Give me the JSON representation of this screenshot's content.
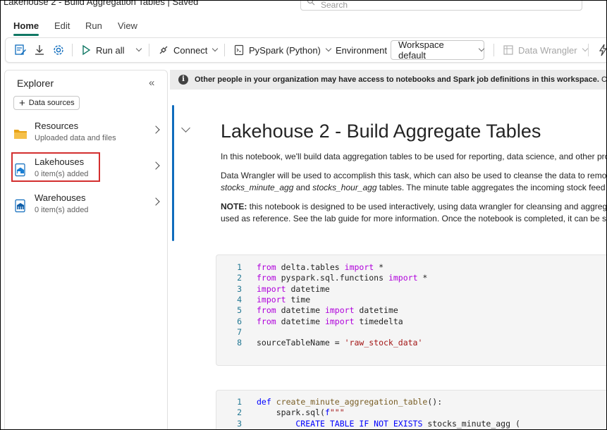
{
  "window": {
    "title": "Lakehouse 2 - Build Aggregation Tables | Saved",
    "search_placeholder": "Search"
  },
  "tabs": [
    {
      "label": "Home",
      "active": true
    },
    {
      "label": "Edit",
      "active": false
    },
    {
      "label": "Run",
      "active": false
    },
    {
      "label": "View",
      "active": false
    }
  ],
  "toolbar": {
    "run_all": "Run all",
    "connect": "Connect",
    "language": "PySpark (Python)",
    "environment": "Environment",
    "workspace": "Workspace default",
    "data_wrangler": "Data Wrangler"
  },
  "explorer": {
    "title": "Explorer",
    "data_sources_button": "Data sources",
    "items": [
      {
        "name": "Resources",
        "sub": "Uploaded data and files",
        "icon": "folder-icon"
      },
      {
        "name": "Lakehouses",
        "sub": "0 item(s) added",
        "icon": "lakehouse-icon"
      },
      {
        "name": "Warehouses",
        "sub": "0 item(s) added",
        "icon": "warehouse-icon"
      }
    ]
  },
  "banner": {
    "bold": "Other people in your organization may have access to notebooks and Spark job definitions in this workspace.",
    "rest": " Carefully revi"
  },
  "markdown": {
    "title": "Lakehouse 2 - Build Aggregate Tables",
    "p1": "In this notebook, we'll build data aggregation tables to be used for reporting, data science, and other pro",
    "p2_line1": "Data Wrangler will be used to accomplish this task, which can also be used to cleanse the data to remov",
    "p2_em1": "stocks_minute_agg",
    "p2_and": " and ",
    "p2_em2": "stocks_hour_agg",
    "p2_tail": " tables. The minute table aggregates the incoming stock feed to",
    "p3_bold": "NOTE:",
    "p3_line1": " this notebook is designed to be used interactively, using data wrangler for cleansing and aggrega",
    "p3_line2": "used as reference. See the lab guide for more information. Once the notebook is completed, it can be sc"
  },
  "code_cell_1": [
    {
      "n": "1",
      "parts": [
        [
          "kw",
          "from"
        ],
        [
          "",
          " delta.tables "
        ],
        [
          "kw",
          "import"
        ],
        [
          "",
          " *"
        ]
      ]
    },
    {
      "n": "2",
      "parts": [
        [
          "kw",
          "from"
        ],
        [
          "",
          " pyspark.sql.functions "
        ],
        [
          "kw",
          "import"
        ],
        [
          "",
          " *"
        ]
      ]
    },
    {
      "n": "3",
      "parts": [
        [
          "kw",
          "import"
        ],
        [
          "",
          " datetime"
        ]
      ]
    },
    {
      "n": "4",
      "parts": [
        [
          "kw",
          "import"
        ],
        [
          "",
          " time"
        ]
      ]
    },
    {
      "n": "5",
      "parts": [
        [
          "kw",
          "from"
        ],
        [
          "",
          " datetime "
        ],
        [
          "kw",
          "import"
        ],
        [
          "",
          " datetime"
        ]
      ]
    },
    {
      "n": "6",
      "parts": [
        [
          "kw",
          "from"
        ],
        [
          "",
          " datetime "
        ],
        [
          "kw",
          "import"
        ],
        [
          "",
          " timedelta"
        ]
      ]
    },
    {
      "n": "7",
      "parts": []
    },
    {
      "n": "8",
      "parts": [
        [
          "",
          "sourceTableName = "
        ],
        [
          "str",
          "'raw_stock_data'"
        ]
      ]
    }
  ],
  "code_cell_2": [
    {
      "n": "1",
      "parts": [
        [
          "kw2",
          "def"
        ],
        [
          "",
          " "
        ],
        [
          "fn",
          "create_minute_aggregation_table"
        ],
        [
          "",
          "():"
        ]
      ]
    },
    {
      "n": "2",
      "parts": [
        [
          "",
          "    spark.sql("
        ],
        [
          "kw2",
          "f"
        ],
        [
          "str",
          "\"\"\""
        ]
      ]
    },
    {
      "n": "3",
      "parts": [
        [
          "kw2",
          "        CREATE TABLE IF NOT EXISTS"
        ],
        [
          "",
          " stocks_minute_agg ("
        ]
      ]
    }
  ]
}
